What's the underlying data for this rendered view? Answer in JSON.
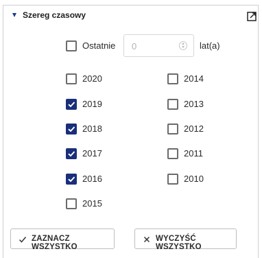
{
  "panel": {
    "title": "Szereg czasowy"
  },
  "last_years": {
    "checkbox_label": "Ostatnie",
    "value": "0",
    "suffix": "lat(a)",
    "checked": false
  },
  "years_left": [
    {
      "label": "2020",
      "checked": false
    },
    {
      "label": "2019",
      "checked": true
    },
    {
      "label": "2018",
      "checked": true
    },
    {
      "label": "2017",
      "checked": true
    },
    {
      "label": "2016",
      "checked": true
    },
    {
      "label": "2015",
      "checked": false
    }
  ],
  "years_right": [
    {
      "label": "2014",
      "checked": false
    },
    {
      "label": "2013",
      "checked": false
    },
    {
      "label": "2012",
      "checked": false
    },
    {
      "label": "2011",
      "checked": false
    },
    {
      "label": "2010",
      "checked": false
    }
  ],
  "buttons": {
    "select_all": "ZAZNACZ WSZYSTKO",
    "clear_all": "WYCZYŚĆ WSZYSTKO"
  },
  "colors": {
    "accent": "#1a2f7a",
    "border": "#cfcfcf"
  }
}
